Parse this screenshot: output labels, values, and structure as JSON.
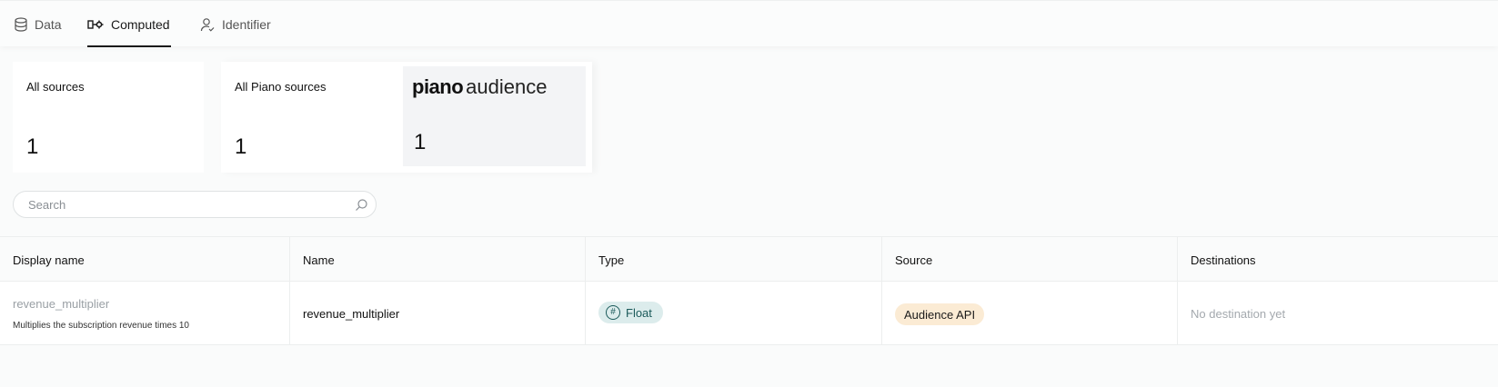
{
  "tabs": [
    {
      "label": "Data",
      "icon": "database-icon",
      "active": false
    },
    {
      "label": "Computed",
      "icon": "computed-icon",
      "active": true
    },
    {
      "label": "Identifier",
      "icon": "user-check-icon",
      "active": false
    }
  ],
  "cards": {
    "all_sources": {
      "label": "All sources",
      "count": "1"
    },
    "all_piano_sources": {
      "label": "All Piano sources",
      "count": "1"
    },
    "piano_audience": {
      "brand": "piano",
      "product": "audience",
      "count": "1"
    }
  },
  "search": {
    "placeholder": "Search",
    "value": ""
  },
  "table": {
    "columns": [
      "Display name",
      "Name",
      "Type",
      "Source",
      "Destinations"
    ],
    "rows": [
      {
        "display_name": "revenue_multiplier",
        "description": "Multiplies the subscription revenue times 10",
        "name": "revenue_multiplier",
        "type": "Float",
        "type_icon": "hash-icon",
        "source": "Audience API",
        "destinations": "No destination yet"
      }
    ]
  },
  "colors": {
    "accent": "#1a1a1a",
    "type_pill_bg": "#dcecec",
    "type_pill_text": "#1b5a5a",
    "source_pill_bg": "#fbebd4"
  }
}
